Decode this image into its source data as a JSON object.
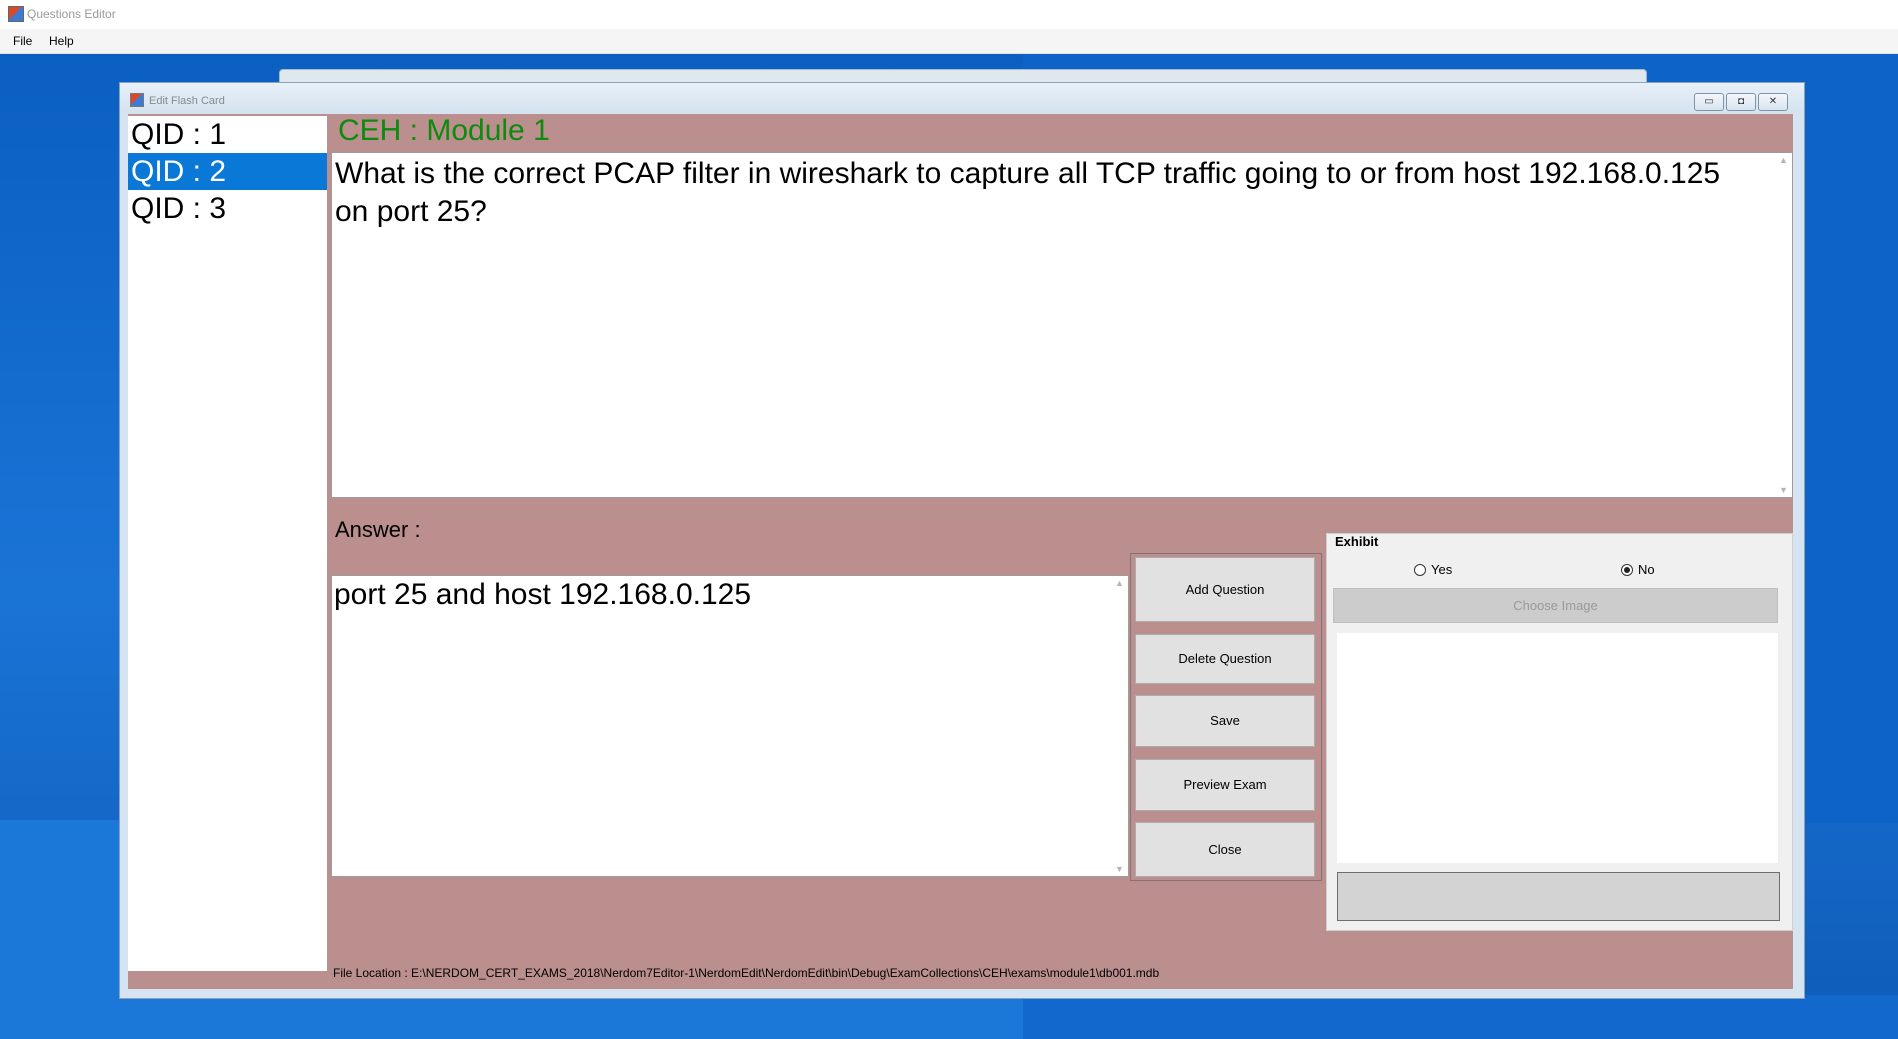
{
  "app": {
    "title": "Questions Editor"
  },
  "menu": {
    "items": [
      "File",
      "Help"
    ]
  },
  "edit_window": {
    "title": "Edit Flash Card",
    "controls": {
      "minimize": "▭",
      "maximize": "◘",
      "close": "✕"
    }
  },
  "qid_list": {
    "items": [
      "QID : 1",
      "QID : 2",
      "QID : 3"
    ],
    "selected_index": 1
  },
  "module_title": "CEH : Module 1",
  "question": {
    "text": "What is the correct PCAP filter in wireshark to capture all TCP traffic going to or from host 192.168.0.125 on port 25?"
  },
  "answer": {
    "label": "Answer :",
    "text": "port 25 and host 192.168.0.125"
  },
  "buttons": {
    "add": "Add Question",
    "delete": "Delete Question",
    "save": "Save",
    "preview": "Preview Exam",
    "close": "Close"
  },
  "exhibit": {
    "legend": "Exhibit",
    "yes_label": "Yes",
    "no_label": "No",
    "selected": "No",
    "choose_image": "Choose Image"
  },
  "file_location": "File Location : E:\\NERDOM_CERT_EXAMS_2018\\Nerdom7Editor-1\\NerdomEdit\\NerdomEdit\\bin\\Debug\\ExamCollections\\CEH\\exams\\module1\\db001.mdb",
  "colors": {
    "panel_background": "#bc8f8f",
    "module_title": "#0e8a0e",
    "selection": "#0a78d7"
  }
}
